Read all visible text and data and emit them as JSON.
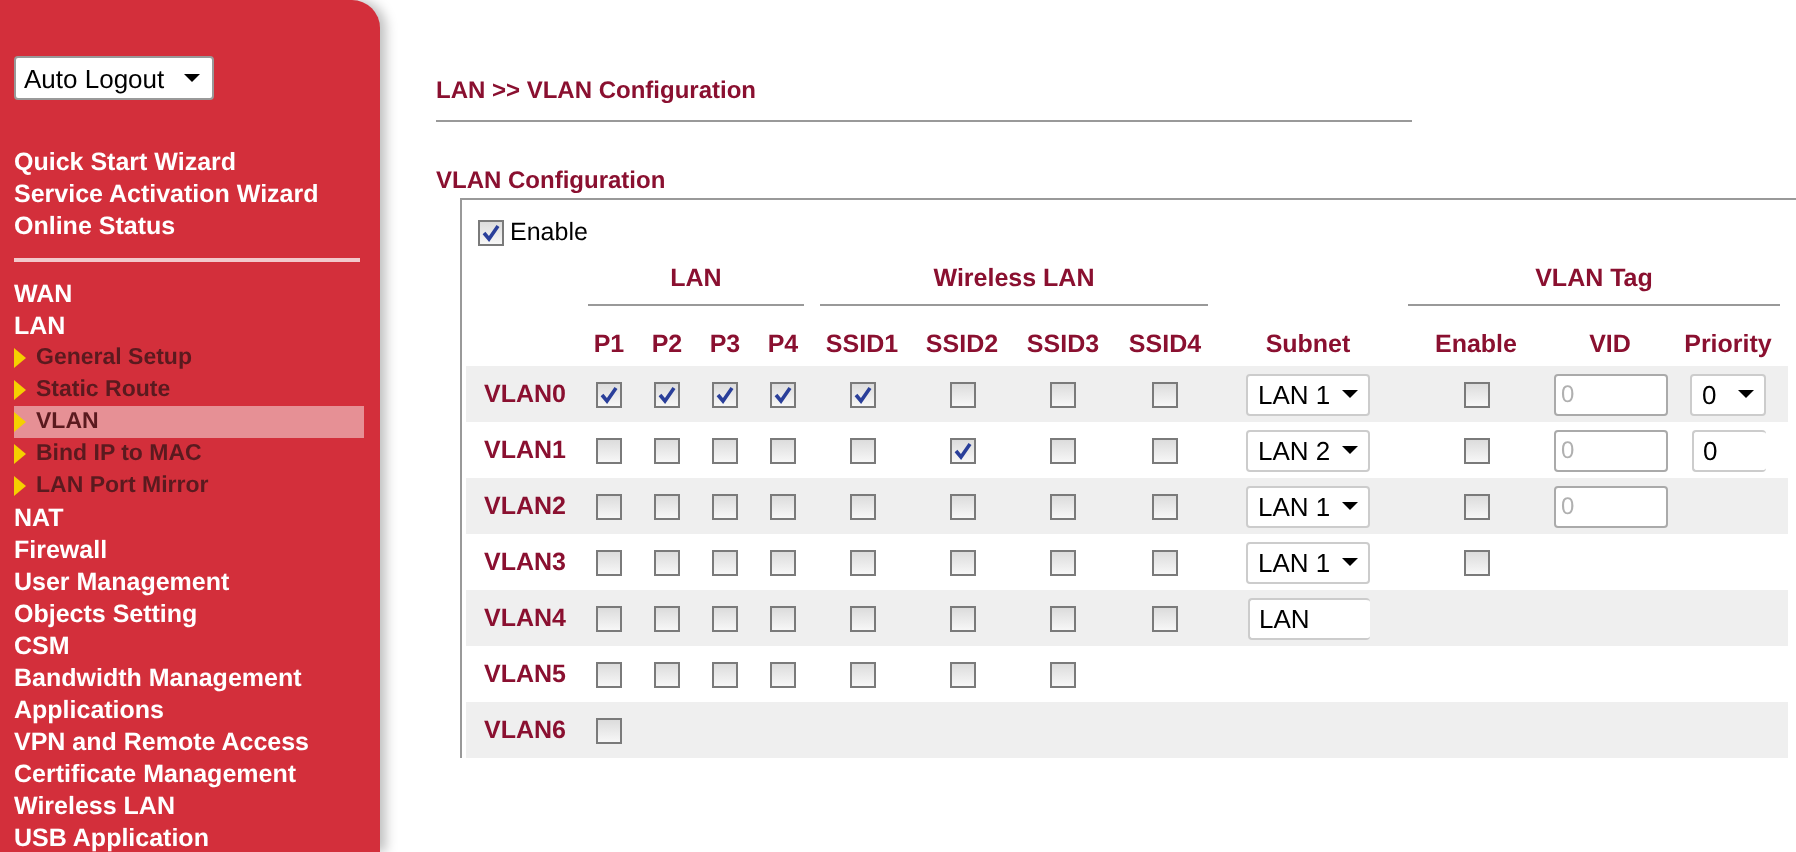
{
  "sidebar": {
    "logout_select": {
      "value": "Auto Logout"
    },
    "sections": [
      [
        {
          "label": "Quick Start Wizard",
          "kind": "main",
          "selected": false
        },
        {
          "label": "Service Activation Wizard",
          "kind": "main",
          "selected": false
        },
        {
          "label": "Online Status",
          "kind": "main",
          "selected": false
        }
      ],
      [
        {
          "label": "WAN",
          "kind": "main",
          "selected": false
        },
        {
          "label": "LAN",
          "kind": "main",
          "selected": false
        },
        {
          "label": "General Setup",
          "kind": "sub",
          "selected": false
        },
        {
          "label": "Static Route",
          "kind": "sub",
          "selected": false
        },
        {
          "label": "VLAN",
          "kind": "sub",
          "selected": true
        },
        {
          "label": "Bind IP to MAC",
          "kind": "sub",
          "selected": false
        },
        {
          "label": "LAN Port Mirror",
          "kind": "sub",
          "selected": false
        },
        {
          "label": "NAT",
          "kind": "main",
          "selected": false
        },
        {
          "label": "Firewall",
          "kind": "main",
          "selected": false
        },
        {
          "label": "User Management",
          "kind": "main",
          "selected": false
        },
        {
          "label": "Objects Setting",
          "kind": "main",
          "selected": false
        },
        {
          "label": "CSM",
          "kind": "main",
          "selected": false
        },
        {
          "label": "Bandwidth Management",
          "kind": "main",
          "selected": false
        },
        {
          "label": "Applications",
          "kind": "main",
          "selected": false
        },
        {
          "label": "VPN and Remote Access",
          "kind": "main",
          "selected": false
        },
        {
          "label": "Certificate Management",
          "kind": "main",
          "selected": false
        },
        {
          "label": "Wireless LAN",
          "kind": "main",
          "selected": false
        },
        {
          "label": "USB Application",
          "kind": "main",
          "selected": false
        }
      ]
    ]
  },
  "breadcrumb": "LAN >> VLAN Configuration",
  "section_title": "VLAN Configuration",
  "enable": {
    "label": "Enable",
    "checked": true
  },
  "group_headers": [
    "LAN",
    "Wireless LAN",
    "VLAN Tag"
  ],
  "columns": [
    "P1",
    "P2",
    "P3",
    "P4",
    "SSID1",
    "SSID2",
    "SSID3",
    "SSID4",
    "Subnet",
    "Enable",
    "VID",
    "Priority"
  ],
  "rows": [
    {
      "name": "VLAN0",
      "cells": [
        {
          "kind": "checkbox",
          "checked": true
        },
        {
          "kind": "checkbox",
          "checked": true
        },
        {
          "kind": "checkbox",
          "checked": true
        },
        {
          "kind": "checkbox",
          "checked": true
        },
        {
          "kind": "checkbox",
          "checked": true
        },
        {
          "kind": "checkbox",
          "checked": false
        },
        {
          "kind": "checkbox",
          "checked": false
        },
        {
          "kind": "checkbox",
          "checked": false
        },
        {
          "kind": "select",
          "value": "LAN 1"
        },
        {
          "kind": "checkbox",
          "checked": false
        },
        {
          "kind": "field",
          "placeholder": "0"
        },
        {
          "kind": "select",
          "value": "0"
        }
      ]
    },
    {
      "name": "VLAN1",
      "cells": [
        {
          "kind": "checkbox",
          "checked": false
        },
        {
          "kind": "checkbox",
          "checked": false
        },
        {
          "kind": "checkbox",
          "checked": false
        },
        {
          "kind": "checkbox",
          "checked": false
        },
        {
          "kind": "checkbox",
          "checked": false
        },
        {
          "kind": "checkbox",
          "checked": true
        },
        {
          "kind": "checkbox",
          "checked": false
        },
        {
          "kind": "checkbox",
          "checked": false
        },
        {
          "kind": "select",
          "value": "LAN 2"
        },
        {
          "kind": "checkbox",
          "checked": false
        },
        {
          "kind": "field",
          "placeholder": "0"
        },
        {
          "kind": "cut-select",
          "value": "0"
        }
      ]
    },
    {
      "name": "VLAN2",
      "cells": [
        {
          "kind": "checkbox",
          "checked": false
        },
        {
          "kind": "checkbox",
          "checked": false
        },
        {
          "kind": "checkbox",
          "checked": false
        },
        {
          "kind": "checkbox",
          "checked": false
        },
        {
          "kind": "checkbox",
          "checked": false
        },
        {
          "kind": "checkbox",
          "checked": false
        },
        {
          "kind": "checkbox",
          "checked": false
        },
        {
          "kind": "checkbox",
          "checked": false
        },
        {
          "kind": "select",
          "value": "LAN 1"
        },
        {
          "kind": "checkbox",
          "checked": false
        },
        {
          "kind": "field",
          "placeholder": "0"
        }
      ]
    },
    {
      "name": "VLAN3",
      "cells": [
        {
          "kind": "checkbox",
          "checked": false
        },
        {
          "kind": "checkbox",
          "checked": false
        },
        {
          "kind": "checkbox",
          "checked": false
        },
        {
          "kind": "checkbox",
          "checked": false
        },
        {
          "kind": "checkbox",
          "checked": false
        },
        {
          "kind": "checkbox",
          "checked": false
        },
        {
          "kind": "checkbox",
          "checked": false
        },
        {
          "kind": "checkbox",
          "checked": false
        },
        {
          "kind": "select",
          "value": "LAN 1"
        },
        {
          "kind": "checkbox",
          "checked": false
        }
      ]
    },
    {
      "name": "VLAN4",
      "cells": [
        {
          "kind": "checkbox",
          "checked": false
        },
        {
          "kind": "checkbox",
          "checked": false
        },
        {
          "kind": "checkbox",
          "checked": false
        },
        {
          "kind": "checkbox",
          "checked": false
        },
        {
          "kind": "checkbox",
          "checked": false
        },
        {
          "kind": "checkbox",
          "checked": false
        },
        {
          "kind": "checkbox",
          "checked": false
        },
        {
          "kind": "checkbox",
          "checked": false
        },
        {
          "kind": "cut-select",
          "value": "LAN"
        }
      ]
    },
    {
      "name": "VLAN5",
      "cells": [
        {
          "kind": "checkbox",
          "checked": false
        },
        {
          "kind": "checkbox",
          "checked": false
        },
        {
          "kind": "checkbox",
          "checked": false
        },
        {
          "kind": "checkbox",
          "checked": false
        },
        {
          "kind": "checkbox",
          "checked": false
        },
        {
          "kind": "checkbox",
          "checked": false
        },
        {
          "kind": "checkbox",
          "checked": false
        }
      ]
    },
    {
      "name": "VLAN6",
      "cells": [
        {
          "kind": "checkbox",
          "checked": false
        }
      ]
    }
  ]
}
